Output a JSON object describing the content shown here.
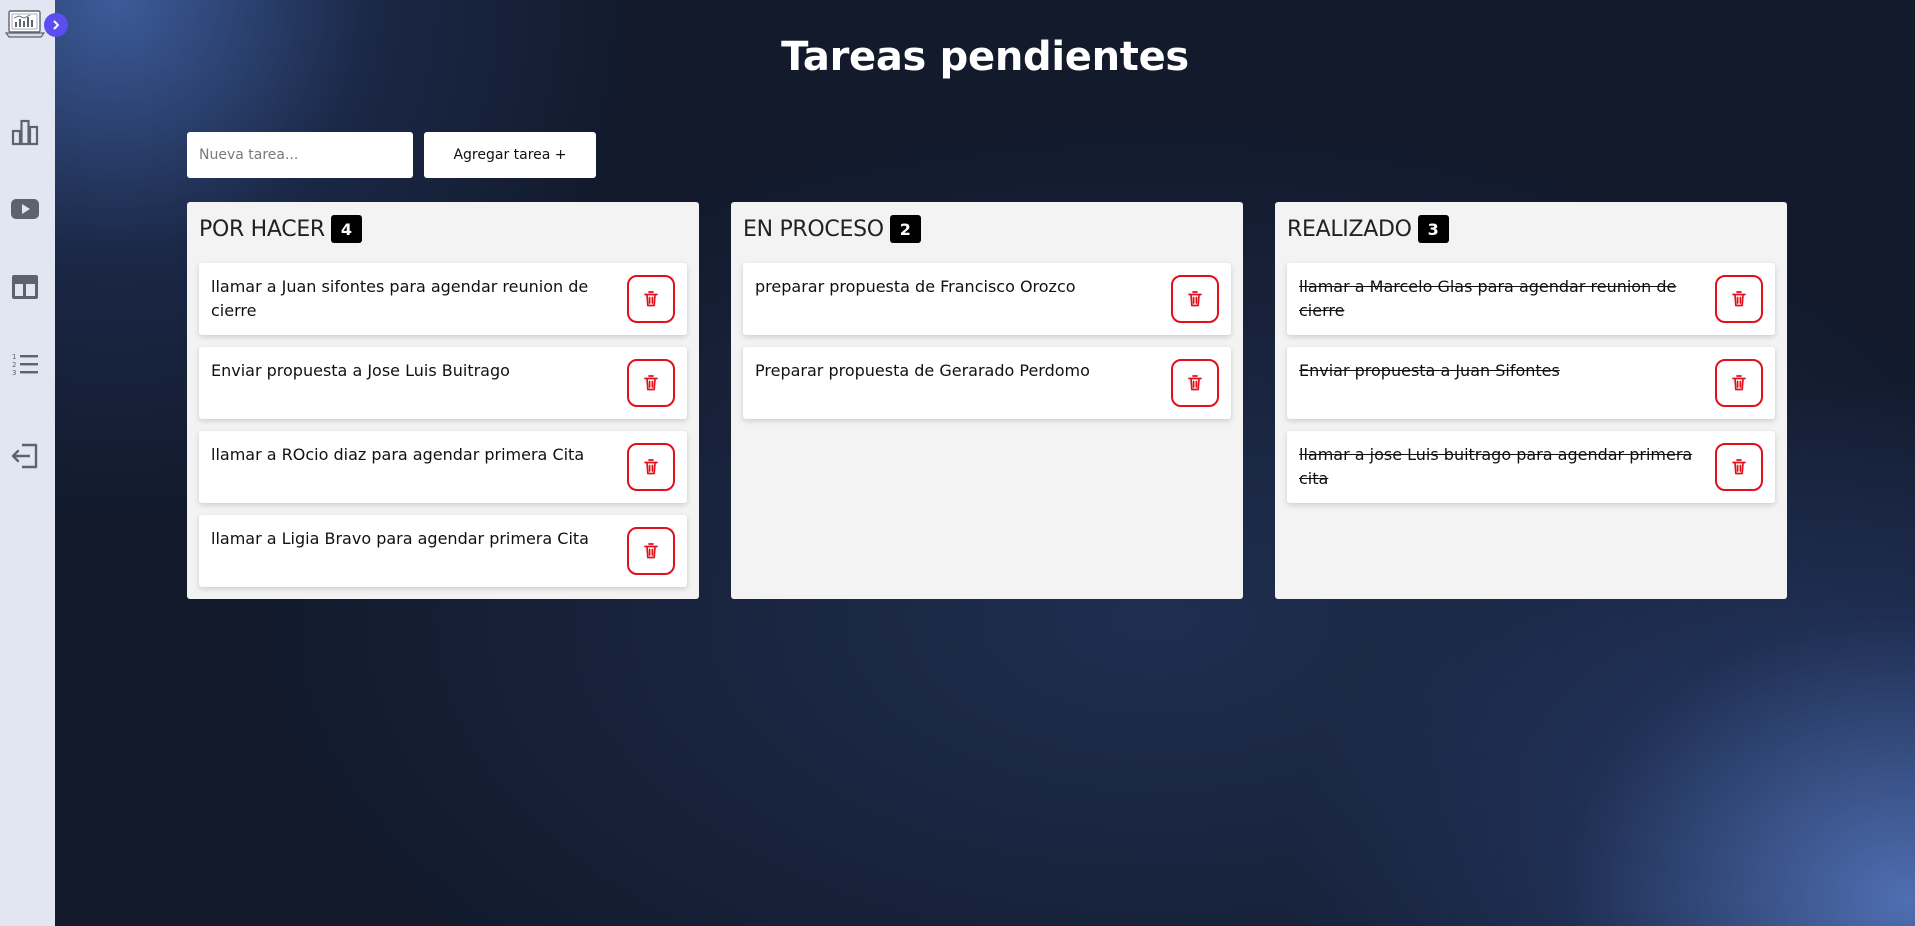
{
  "colors": {
    "sidebar_bg": "#e2e6f3",
    "accent": "#5b4ef0",
    "delete": "#e0111b",
    "count_badge": "#000000"
  },
  "sidebar": {
    "logo_icon": "analytics-laptop-icon",
    "toggle_icon": "chevron-right-icon",
    "items": [
      {
        "icon": "bar-chart-icon"
      },
      {
        "icon": "video-play-icon"
      },
      {
        "icon": "dashboard-layout-icon"
      },
      {
        "icon": "numbered-list-icon"
      },
      {
        "icon": "logout-icon"
      }
    ]
  },
  "page": {
    "title": "Tareas pendientes"
  },
  "new_task": {
    "placeholder": "Nueva tarea...",
    "value": "",
    "add_label": "Agregar tarea +"
  },
  "columns": [
    {
      "title": "POR HACER",
      "count": "4",
      "tasks": [
        {
          "text": "llamar a Juan sifontes para agendar reunion de cierre"
        },
        {
          "text": "Enviar propuesta a Jose Luis Buitrago"
        },
        {
          "text": "llamar a ROcio diaz para agendar primera Cita"
        },
        {
          "text": "llamar a Ligia Bravo para agendar primera Cita"
        }
      ]
    },
    {
      "title": "EN PROCESO",
      "count": "2",
      "tasks": [
        {
          "text": "preparar propuesta de Francisco Orozco"
        },
        {
          "text": "Preparar propuesta de Gerarado Perdomo"
        }
      ]
    },
    {
      "title": "REALIZADO",
      "count": "3",
      "tasks": [
        {
          "text": "llamar a Marcelo Glas para agendar reunion de cierre"
        },
        {
          "text": "Enviar propuesta a Juan Sifontes"
        },
        {
          "text": "llamar a jose Luis buitrago para agendar primera cita"
        }
      ]
    }
  ]
}
